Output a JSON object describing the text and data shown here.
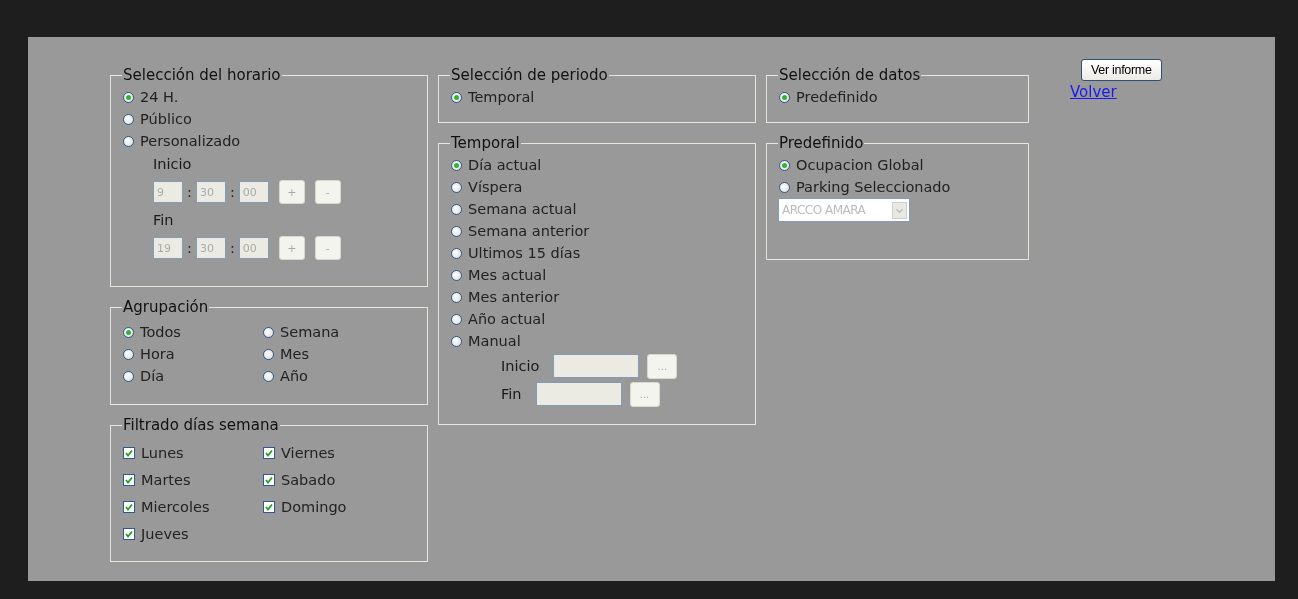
{
  "horario": {
    "title": "Selección del horario",
    "options": [
      {
        "label": "24 H.",
        "selected": true
      },
      {
        "label": "Público",
        "selected": false
      },
      {
        "label": "Personalizado",
        "selected": false
      }
    ],
    "times": [
      {
        "label": "Inicio",
        "fields": [
          "9",
          "30",
          "00"
        ],
        "separator": ":",
        "buttons": [
          "+",
          "-"
        ],
        "disabled": true
      },
      {
        "label": "Fin",
        "fields": [
          "19",
          "30",
          "00"
        ],
        "separator": ":",
        "buttons": [
          "+",
          "-"
        ],
        "disabled": true
      }
    ]
  },
  "agrupacion": {
    "title": "Agrupación",
    "options": [
      {
        "label": "Todos",
        "selected": true
      },
      {
        "label": "Hora",
        "selected": false
      },
      {
        "label": "Día",
        "selected": false
      },
      {
        "label": "Semana",
        "selected": false
      },
      {
        "label": "Mes",
        "selected": false
      },
      {
        "label": "Año",
        "selected": false
      }
    ]
  },
  "filtrado": {
    "title": "Filtrado días semana",
    "days": [
      {
        "label": "Lunes",
        "checked": true
      },
      {
        "label": "Martes",
        "checked": true
      },
      {
        "label": "Miercoles",
        "checked": true
      },
      {
        "label": "Jueves",
        "checked": true
      },
      {
        "label": "Viernes",
        "checked": true
      },
      {
        "label": "Sabado",
        "checked": true
      },
      {
        "label": "Domingo",
        "checked": true
      }
    ]
  },
  "periodo": {
    "title": "Selección de periodo",
    "options": [
      {
        "label": "Temporal",
        "selected": true
      }
    ]
  },
  "temporal": {
    "title": "Temporal",
    "options": [
      {
        "label": "Día actual",
        "selected": true
      },
      {
        "label": "Víspera",
        "selected": false
      },
      {
        "label": "Semana actual",
        "selected": false
      },
      {
        "label": "Semana anterior",
        "selected": false
      },
      {
        "label": "Ultimos 15 días",
        "selected": false
      },
      {
        "label": "Mes actual",
        "selected": false
      },
      {
        "label": "Mes anterior",
        "selected": false
      },
      {
        "label": "Año actual",
        "selected": false
      },
      {
        "label": "Manual",
        "selected": false
      }
    ],
    "dates": [
      {
        "label": "Inicio",
        "button": "...",
        "disabled": true
      },
      {
        "label": "Fin",
        "button": "...",
        "disabled": true
      }
    ]
  },
  "datos": {
    "title": "Selección de datos",
    "options": [
      {
        "label": "Predefinido",
        "selected": true
      }
    ]
  },
  "predefinido": {
    "title": "Predefinido",
    "options": [
      {
        "label": "Ocupacion Global",
        "selected": true
      },
      {
        "label": "Parking Seleccionado",
        "selected": false
      }
    ],
    "select": {
      "value": "ARCCO AMARA",
      "disabled": true
    }
  },
  "actions": {
    "button": "Ver informe",
    "link": "Volver"
  }
}
